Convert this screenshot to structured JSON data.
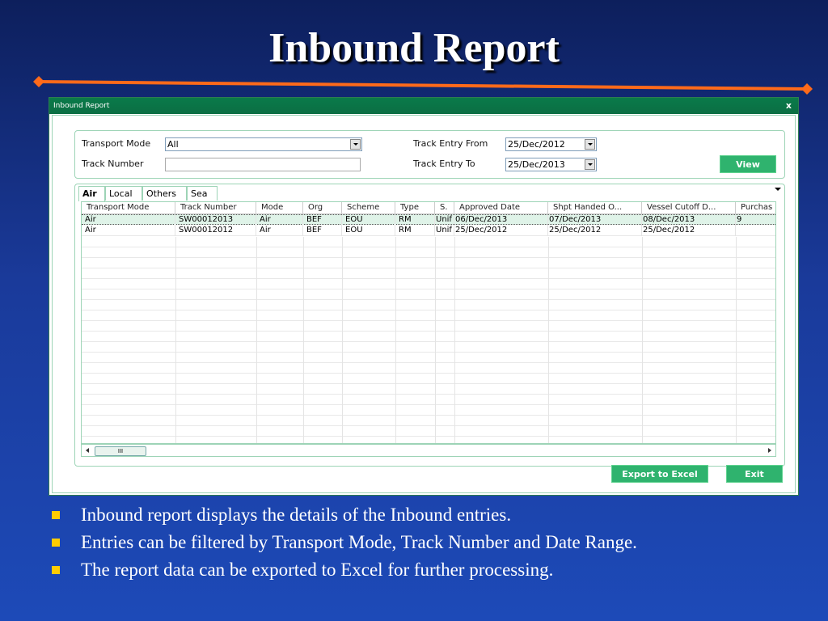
{
  "slide": {
    "title": "Inbound Report",
    "accent_color": "#ff6a1a",
    "bullets": [
      "Inbound report displays the details of the Inbound entries.",
      "Entries can be filtered by Transport Mode, Track Number and Date Range.",
      "The report data can be exported to Excel for further processing."
    ]
  },
  "window": {
    "title": "Inbound Report",
    "close_label": "x"
  },
  "filters": {
    "transport_mode_label": "Transport Mode",
    "transport_mode_value": "All",
    "track_number_label": "Track Number",
    "track_number_value": "",
    "track_entry_from_label": "Track Entry From",
    "track_entry_from_value": "25/Dec/2012",
    "track_entry_to_label": "Track Entry To",
    "track_entry_to_value": "25/Dec/2013",
    "view_button": "View"
  },
  "tabs": [
    "Air",
    "Local",
    "Others",
    "Sea"
  ],
  "table": {
    "columns": [
      "Transport Mode",
      "Track Number",
      "Mode",
      "Org",
      "Scheme",
      "Type",
      "S.",
      "Approved Date",
      "Shpt Handed O...",
      "Vessel Cutoff D...",
      "Purchas"
    ],
    "rows": [
      [
        "Air",
        "SW00012013",
        "Air",
        "BEF",
        "EOU",
        "RM",
        "Unif",
        "06/Dec/2013",
        "07/Dec/2013",
        "08/Dec/2013",
        "9"
      ],
      [
        "Air",
        "SW00012012",
        "Air",
        "BEF",
        "EOU",
        "RM",
        "Unif",
        "25/Dec/2012",
        "25/Dec/2012",
        "25/Dec/2012",
        ""
      ]
    ],
    "scroll_thumb_label": "III"
  },
  "footer": {
    "export_button": "Export to Excel",
    "exit_button": "Exit"
  }
}
